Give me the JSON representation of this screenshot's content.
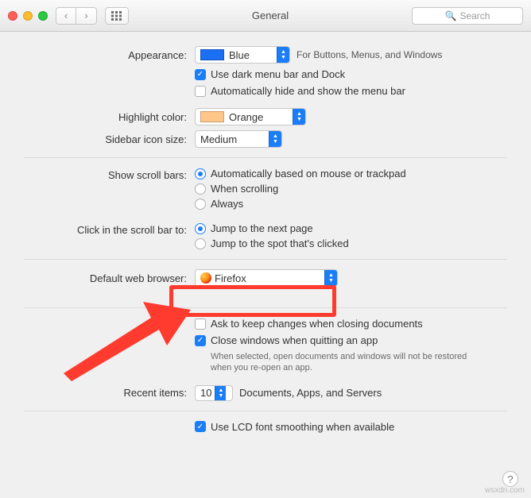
{
  "titlebar": {
    "title": "General",
    "search_placeholder": "Search"
  },
  "appearance": {
    "label": "Appearance:",
    "value": "Blue",
    "hint": "For Buttons, Menus, and Windows",
    "dark_menu": "Use dark menu bar and Dock",
    "auto_hide": "Automatically hide and show the menu bar"
  },
  "highlight": {
    "label": "Highlight color:",
    "value": "Orange",
    "swatch": "#ffc68a"
  },
  "sidebar": {
    "label": "Sidebar icon size:",
    "value": "Medium"
  },
  "scrollbars": {
    "label": "Show scroll bars:",
    "options": [
      "Automatically based on mouse or trackpad",
      "When scrolling",
      "Always"
    ],
    "selected": 0
  },
  "scrollclick": {
    "label": "Click in the scroll bar to:",
    "options": [
      "Jump to the next page",
      "Jump to the spot that's clicked"
    ],
    "selected": 0
  },
  "browser": {
    "label": "Default web browser:",
    "value": "Firefox"
  },
  "docs": {
    "ask": "Ask to keep changes when closing documents",
    "close": "Close windows when quitting an app",
    "hint": "When selected, open documents and windows will not be restored when you re-open an app."
  },
  "recent": {
    "label": "Recent items:",
    "value": "10",
    "hint": "Documents, Apps, and Servers"
  },
  "lcd": "Use LCD font smoothing when available",
  "watermark": "wsxdn.com"
}
